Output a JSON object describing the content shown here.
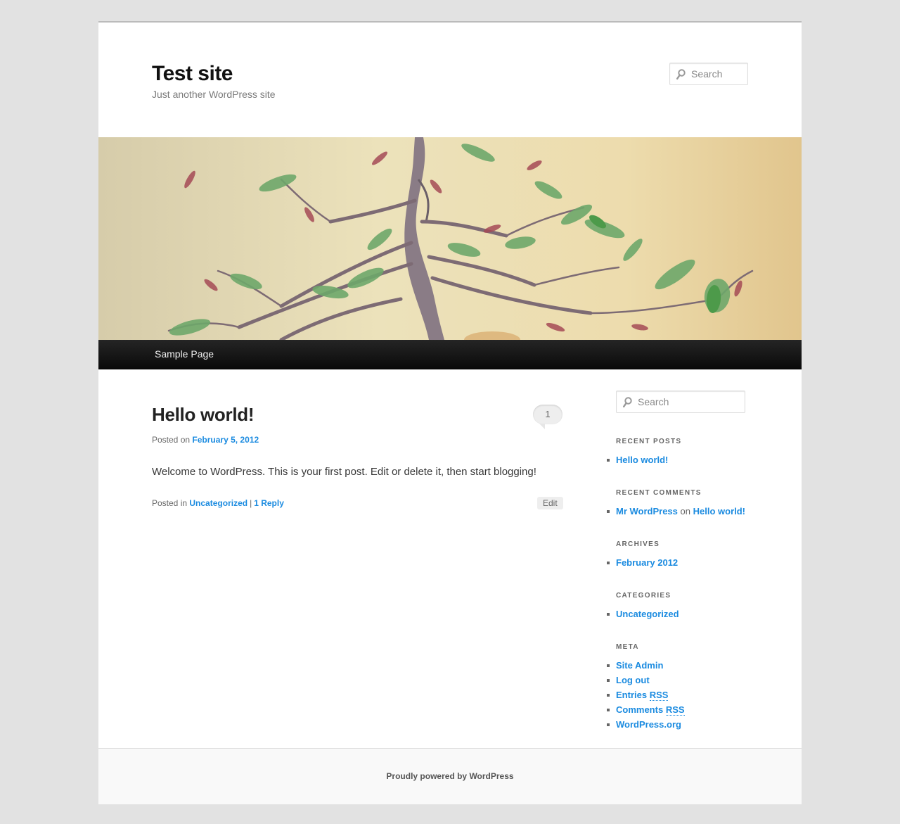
{
  "site": {
    "title": "Test site",
    "description": "Just another WordPress site"
  },
  "header_search": {
    "placeholder": "Search"
  },
  "nav": {
    "items": [
      {
        "label": "Sample Page"
      }
    ]
  },
  "post": {
    "title": "Hello world!",
    "comment_count": "1",
    "meta_prefix": "Posted on",
    "date": "February 5, 2012",
    "content": "Welcome to WordPress. This is your first post. Edit or delete it, then start blogging!",
    "footer_prefix": "Posted in",
    "category": "Uncategorized",
    "separator": "|",
    "reply_link": "1 Reply",
    "edit_label": "Edit"
  },
  "sidebar": {
    "search": {
      "placeholder": "Search"
    },
    "recent_posts": {
      "title": "Recent Posts",
      "items": [
        "Hello world!"
      ]
    },
    "recent_comments": {
      "title": "Recent Comments",
      "author": "Mr WordPress",
      "connector": "on",
      "post": "Hello world!"
    },
    "archives": {
      "title": "Archives",
      "items": [
        "February 2012"
      ]
    },
    "categories": {
      "title": "Categories",
      "items": [
        "Uncategorized"
      ]
    },
    "meta": {
      "title": "Meta",
      "site_admin": "Site Admin",
      "log_out": "Log out",
      "entries_prefix": "Entries",
      "comments_prefix": "Comments",
      "rss": "RSS",
      "wordpress_org": "WordPress.org"
    }
  },
  "footer": {
    "credit": "Proudly powered by WordPress"
  },
  "colors": {
    "link": "#1b8be0",
    "background": "#e2e2e2",
    "nav_bar": "#111111"
  }
}
